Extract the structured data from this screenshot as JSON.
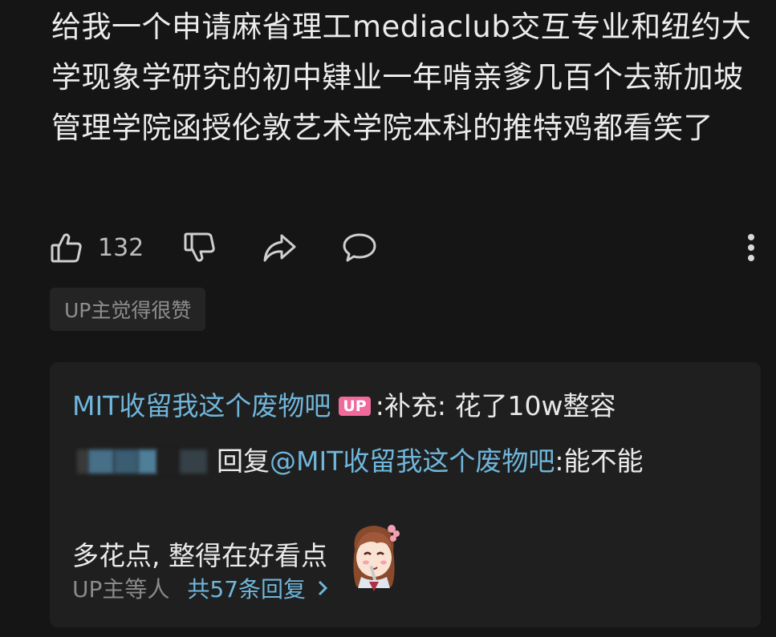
{
  "comment": {
    "text": "给我一个申请麻省理工mediaclub交互专业和纽约大学现象学研究的初中肄业一年啃亲爹几百个去新加坡管理学院函授伦敦艺术学院本科的推特鸡都看笑了",
    "like_count": "132",
    "up_liked_badge": "UP主觉得很赞"
  },
  "replies": {
    "reply1": {
      "author": "MIT收留我这个废物吧",
      "badge": "UP",
      "separator": " : ",
      "text": "补充: 花了10w整容"
    },
    "reply2": {
      "reply_word": "回复 ",
      "mention": "@MIT收留我这个废物吧",
      "text_line1": " :能不能",
      "text_line2": "多花点, 整得在好看点"
    },
    "footer": {
      "up_waiting": "UP主等人",
      "view_all": "共57条回复"
    }
  },
  "icons": {
    "like": "thumbs-up-icon",
    "dislike": "thumbs-down-icon",
    "share": "share-icon",
    "comment": "comment-icon",
    "more": "more-vertical-icon",
    "chevron": "chevron-right-icon",
    "sticker": "sticker-girl-icon"
  },
  "colors": {
    "background": "#151515",
    "reply_box": "#1f1f1f",
    "link": "#6fb6db",
    "up_badge": "#f06a9b"
  }
}
